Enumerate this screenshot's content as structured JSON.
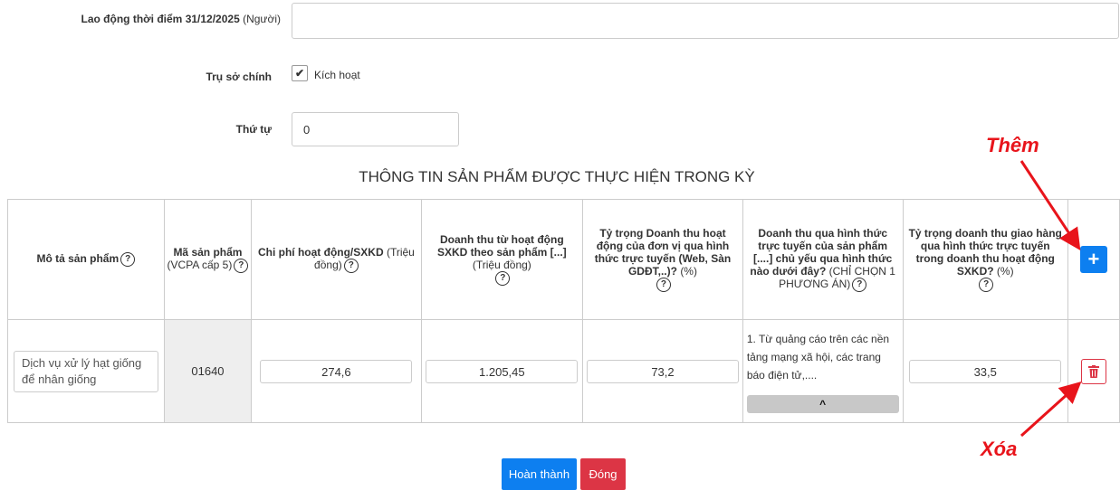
{
  "form": {
    "labor_label": "Lao động thời điểm 31/12/2025",
    "labor_unit": "(Người)",
    "labor_value": "",
    "headquarters_label": "Trụ sở chính",
    "headquarters_checkbox_label": "Kích hoạt",
    "order_label": "Thứ tự",
    "order_value": "0"
  },
  "section_title": "THÔNG TIN SẢN PHẨM ĐƯỢC THỰC HIỆN TRONG KỲ",
  "table": {
    "headers": {
      "description": "Mô tả sản phẩm",
      "code_bold": "Mã sản phẩm",
      "code_norm": "(VCPA cấp 5)",
      "cost_bold": "Chi phí hoạt động/SXKD",
      "cost_norm": "(Triệu đồng)",
      "revenue_bold": "Doanh thu từ hoạt động SXKD theo sản phẩm [...]",
      "revenue_norm": "(Triệu đồng)",
      "online_share_bold": "Tỷ trọng Doanh thu hoạt động của đơn vị qua hình thức trực tuyến (Web, Sàn GDĐT,..)?",
      "online_share_norm": "(%)",
      "online_form_bold": "Doanh thu qua hình thức trực tuyến của sản phẩm [....] chủ yếu qua hình thức nào dưới đây?",
      "online_form_norm": "(CHỈ CHỌN 1 PHƯƠNG ÁN)",
      "delivery_share_bold": "Tỷ trọng doanh thu giao hàng qua hình thức trực tuyến trong doanh thu hoạt động SXKD?",
      "delivery_share_norm": "(%)",
      "help_glyph": "?"
    },
    "rows": [
      {
        "description": "Dịch vụ xử lý hạt giống để nhân giống",
        "code": "01640",
        "cost": "274,6",
        "revenue": "1.205,45",
        "online_share": "73,2",
        "online_form": "1. Từ quảng cáo trên các nền tảng mạng xã hội, các trang báo điện tử,....",
        "delivery_share": "33,5"
      }
    ],
    "add_button_glyph": "+",
    "delete_icon": "trash-icon",
    "collapse_icon": "chevron-up-icon"
  },
  "annotations": {
    "add_label": "Thêm",
    "delete_label": "Xóa",
    "color": "#e8141b"
  },
  "buttons": {
    "complete": "Hoàn thành",
    "close": "Đóng"
  },
  "colors": {
    "primary": "#0d7ff0",
    "danger": "#dc3545",
    "annotation": "#e8141b"
  }
}
